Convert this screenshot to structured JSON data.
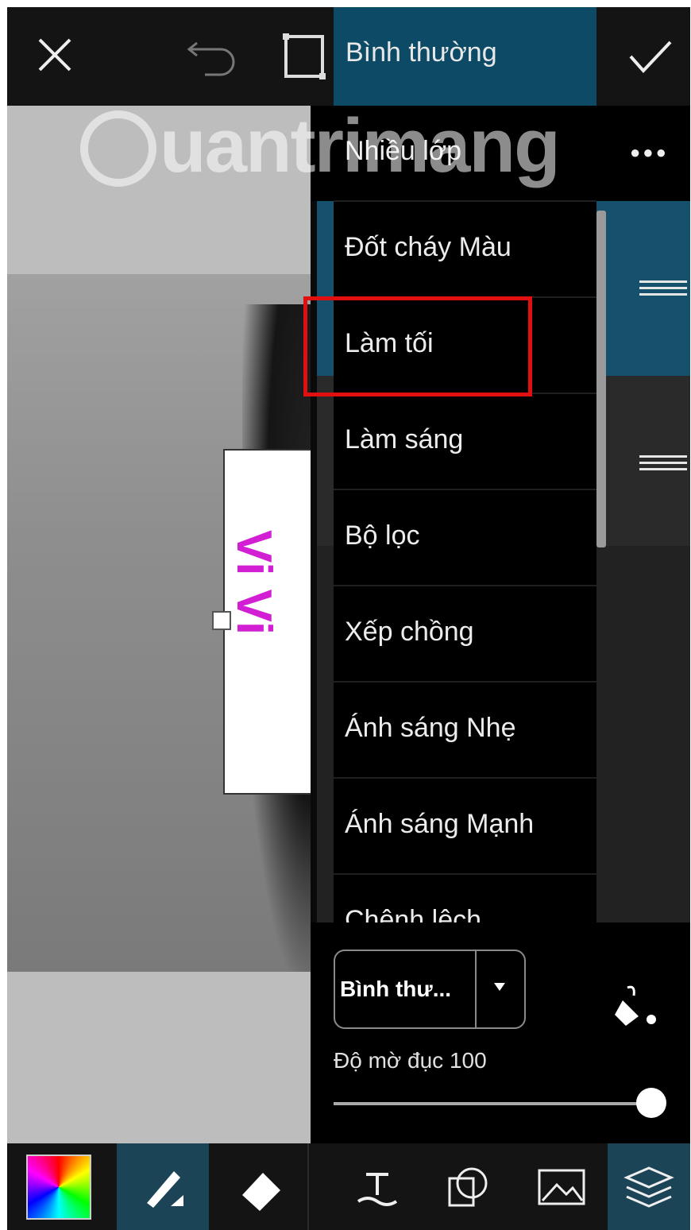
{
  "topbar": {
    "blend_mode_label": "Bình thường"
  },
  "menu": {
    "items": [
      {
        "label": "Nhiều lớp"
      },
      {
        "label": "Đốt cháy Màu"
      },
      {
        "label": "Làm tối"
      },
      {
        "label": "Làm sáng"
      },
      {
        "label": "Bộ lọc"
      },
      {
        "label": "Xếp chồng"
      },
      {
        "label": "Ánh sáng Nhẹ"
      },
      {
        "label": "Ánh sáng Mạnh"
      },
      {
        "label": "Chênh lệch"
      }
    ],
    "highlighted": "Làm tối"
  },
  "canvas": {
    "layer_text": "Vi Vi"
  },
  "controls": {
    "blend_select_value": "Bình thư...",
    "opacity_label": "Độ mờ đục 100",
    "opacity_value": 100
  },
  "watermark": {
    "text": "uantrimang"
  },
  "colors": {
    "accent": "#0d4a66",
    "highlight_border": "#e01010",
    "layer_text": "#d21fd4"
  },
  "icons": [
    "close-icon",
    "undo-icon",
    "crop-icon",
    "check-icon",
    "more-icon",
    "drag-handle-icon",
    "fill-bucket-icon",
    "color-picker-icon",
    "brush-icon",
    "eraser-icon",
    "text-icon",
    "shape-icon",
    "image-icon",
    "layers-icon"
  ]
}
